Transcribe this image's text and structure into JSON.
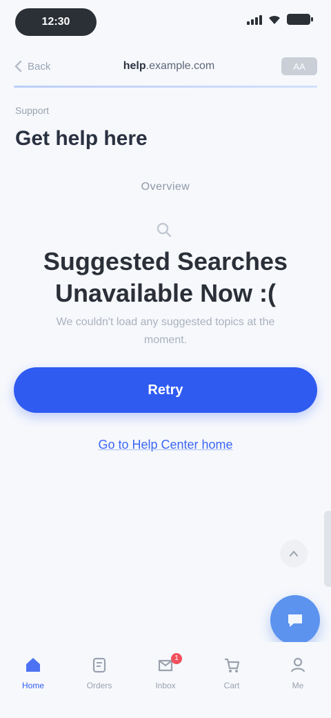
{
  "status_bar": {
    "time": "12:30"
  },
  "address_bar": {
    "back_label": "Back",
    "domain": "help",
    "path": ".example.com",
    "action_label": "AA"
  },
  "header": {
    "breadcrumb": "Support",
    "title": "Get help here"
  },
  "section_label": "Overview",
  "empty_state": {
    "headline_line1": "Suggested Searches",
    "headline_line2": "Unavailable Now :(",
    "subtext_line1": "We couldn't load any suggested topics at the",
    "subtext_line2": "moment.",
    "primary_button": "Retry",
    "secondary_link": "Go to Help Center home"
  },
  "bottom_nav": [
    {
      "label": "Home",
      "icon": "home-icon",
      "active": true
    },
    {
      "label": "Orders",
      "icon": "orders-icon",
      "active": false
    },
    {
      "label": "Inbox",
      "icon": "inbox-icon",
      "active": false,
      "badge": "1"
    },
    {
      "label": "Cart",
      "icon": "cart-icon",
      "active": false
    },
    {
      "label": "Me",
      "icon": "profile-icon",
      "active": false
    }
  ],
  "colors": {
    "accent": "#2f5bf1",
    "fab": "#5b93ef",
    "background": "#f6f8fc",
    "badge": "#f0505e"
  }
}
